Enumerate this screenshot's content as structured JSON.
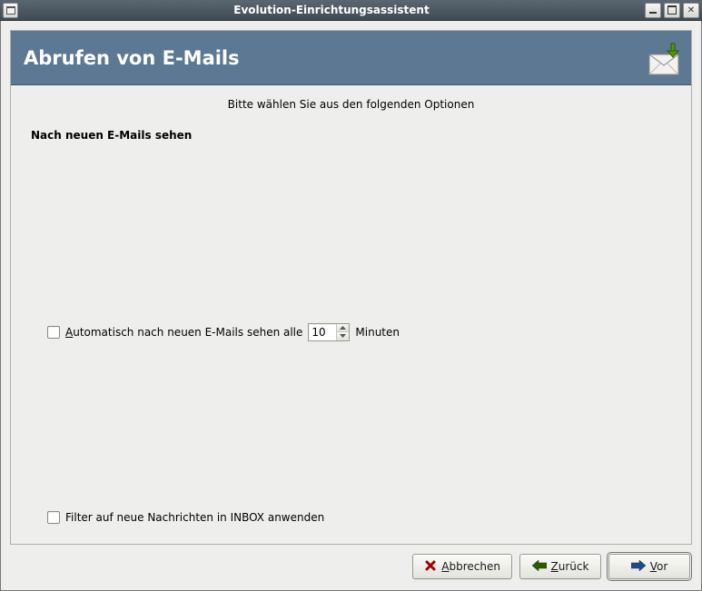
{
  "window": {
    "title": "Evolution-Einrichtungsassistent"
  },
  "banner": {
    "heading": "Abrufen von E-Mails"
  },
  "content": {
    "instruction": "Bitte wählen Sie aus den folgenden Optionen",
    "section_label": "Nach neuen E-Mails sehen",
    "auto_check": {
      "label_before": "A",
      "label_after": "utomatisch nach neuen E-Mails sehen alle",
      "minutes_value": "10",
      "minutes_unit": "Minuten"
    },
    "filter": {
      "label": "Filter auf neue Nachrichten in INBOX anwenden"
    }
  },
  "buttons": {
    "cancel": {
      "ul": "A",
      "rest": "bbrechen"
    },
    "back": {
      "ul": "Z",
      "rest": "urück"
    },
    "next": {
      "ul": "V",
      "rest": "or"
    }
  }
}
